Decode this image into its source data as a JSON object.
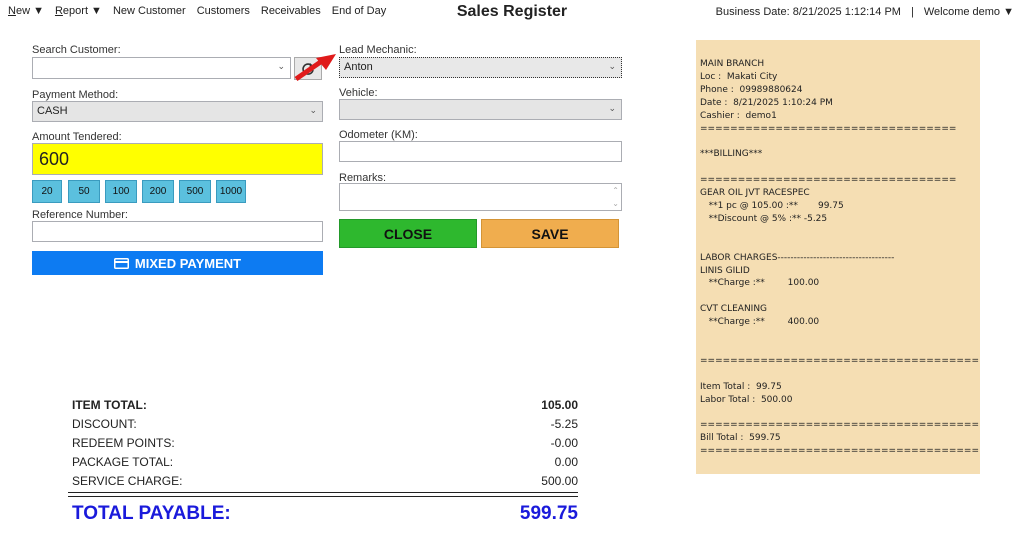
{
  "nav": {
    "items": [
      "New ▼",
      "Report ▼",
      "New Customer",
      "Customers",
      "Receivables",
      "End of Day"
    ]
  },
  "title": "Sales Register",
  "header": {
    "business_date": "Business Date: 8/21/2025 1:12:14 PM",
    "separator": "|",
    "welcome": "Welcome demo ▼"
  },
  "form": {
    "search_customer_label": "Search Customer:",
    "search_customer_value": "",
    "payment_method_label": "Payment Method:",
    "payment_method_value": "CASH",
    "amount_tendered_label": "Amount Tendered:",
    "amount_tendered_value": "600",
    "quick_amounts": [
      "20",
      "50",
      "100",
      "200",
      "500",
      "1000"
    ],
    "reference_label": "Reference Number:",
    "reference_value": "",
    "mixed_payment_label": "MIXED PAYMENT",
    "lead_mechanic_label": "Lead Mechanic:",
    "lead_mechanic_value": "Anton",
    "vehicle_label": "Vehicle:",
    "vehicle_value": "",
    "odometer_label": "Odometer (KM):",
    "odometer_value": "",
    "remarks_label": "Remarks:",
    "remarks_value": "",
    "close_label": "CLOSE",
    "save_label": "SAVE"
  },
  "totals": {
    "rows": [
      {
        "label": "ITEM TOTAL:",
        "value": "105.00"
      },
      {
        "label": "DISCOUNT:",
        "value": "-5.25"
      },
      {
        "label": "REDEEM POINTS:",
        "value": "-0.00"
      },
      {
        "label": "PACKAGE TOTAL:",
        "value": "0.00"
      },
      {
        "label": "SERVICE CHARGE:",
        "value": "500.00"
      }
    ],
    "payable_label": "TOTAL PAYABLE:",
    "payable_value": "599.75"
  },
  "receipt": {
    "lines": [
      "MAIN BRANCH",
      "Loc :  Makati City",
      "Phone :  09989880624",
      "Date :  8/21/2025 1:10:24 PM",
      "Cashier :  demo1",
      "==================================",
      "",
      "***BILLING***",
      "",
      "==================================",
      "GEAR OIL JVT RACESPEC",
      "   **1 pc @ 105.00 :**       99.75",
      "   **Discount @ 5% :** -5.25",
      "",
      "",
      "LABOR CHARGES------------------------------------",
      "LINIS GILID",
      "   **Charge :**        100.00",
      "",
      "CVT CLEANING",
      "   **Charge :**        400.00",
      "",
      "",
      "=====================================",
      "",
      "Item Total :  99.75",
      "Labor Total :  500.00",
      "",
      "=====================================",
      "Bill Total :  599.75",
      "====================================="
    ]
  },
  "colors": {
    "amount_bg": "#ffff00",
    "quick_btn": "#5bc0de",
    "mixed_payment": "#0d7bf2",
    "close": "#2eb82e",
    "save": "#f0ad4e",
    "receipt_bg": "#f5deb3",
    "payable_text": "#1a1adb"
  }
}
